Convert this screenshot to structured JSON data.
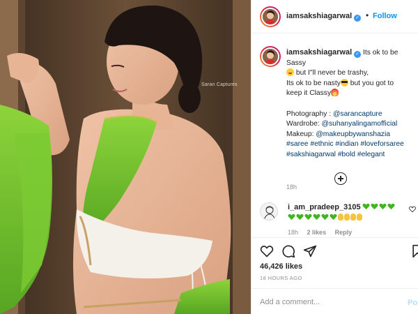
{
  "post": {
    "username": "iamsakshiagarwal",
    "follow_label": "Follow",
    "photo_credit": "Saran Captures"
  },
  "caption": {
    "username": "iamsakshiagarwal",
    "line1": "Its ok to be Sassy",
    "line2": "but I\"ll never be trashy,",
    "line3a": "Its ok to be nasty",
    "line3b": "but you got to",
    "line4": "keep it Classy",
    "photography_label": "Photography : ",
    "photography_handle": "@sarancapture",
    "wardrobe_label": "Wardrobe: ",
    "wardrobe_handle": "@suhanyalingamofficial",
    "makeup_label": "Makeup: ",
    "makeup_handle": "@makeupbywanshazia",
    "tags_line1": "#saree #ethnic #indian #loveforsaree",
    "tags_line2": "#sakshiagarwal #bold #elegant",
    "time": "18h"
  },
  "comment": {
    "username": "i_am_pradeep_3105",
    "time": "18h",
    "likes": "2 likes",
    "reply_label": "Reply"
  },
  "stats": {
    "likes": "46,426 likes",
    "time_ago": "18 HOURS AGO"
  },
  "add_comment": {
    "placeholder": "Add a comment...",
    "post_label": "Post"
  },
  "colors": {
    "accent": "#0095f6",
    "verified": "#3897f0",
    "saree_green": "#6cc230"
  },
  "icons": [
    "verified-icon",
    "heart-icon",
    "comment-icon",
    "share-icon",
    "bookmark-icon",
    "plus-circle-icon"
  ]
}
